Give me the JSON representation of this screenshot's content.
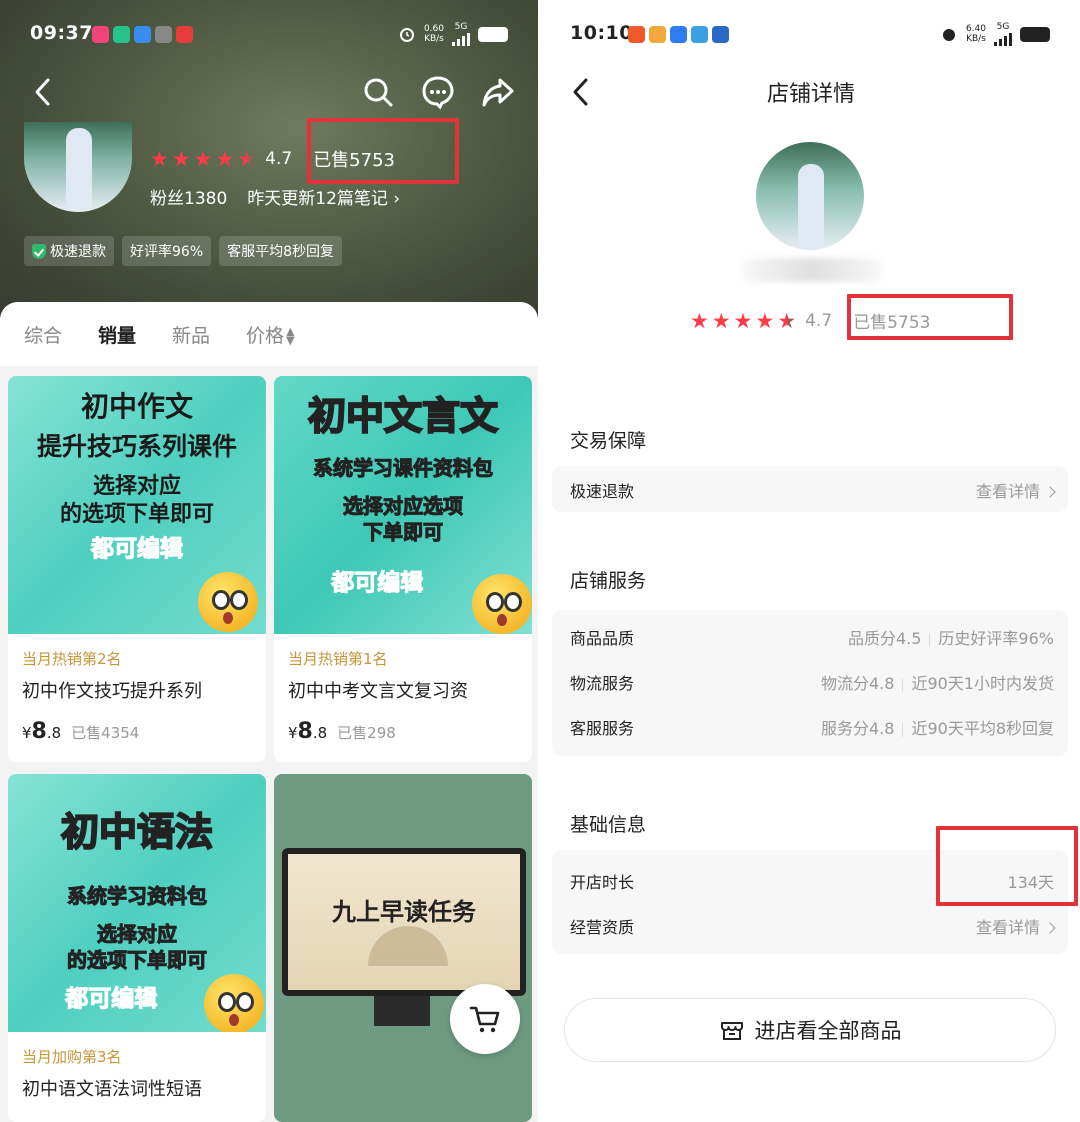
{
  "left": {
    "status": {
      "time": "09:37",
      "net_speed": "0.60",
      "net_unit": "KB/s",
      "net_type": "5G",
      "app_icons": [
        "#f0447a",
        "#28c28d",
        "#3b8cf0",
        "#888888",
        "#e83c3c"
      ]
    },
    "shop": {
      "rating": "4.7",
      "sold": "已售5753",
      "fans": "粉丝1380",
      "update": "昨天更新12篇笔记",
      "chips": [
        "极速退款",
        "好评率96%",
        "客服平均8秒回复"
      ]
    },
    "sort_tabs": [
      "综合",
      "销量",
      "新品",
      "价格"
    ],
    "products": [
      {
        "thumb_lines": [
          "初中作文",
          "提升技巧系列课件",
          "选择对应",
          "的选项下单即可",
          "都可编辑"
        ],
        "rank": "当月热销第2名",
        "title": "初中作文技巧提升系列",
        "currency": "¥",
        "price_int": "8",
        "price_dec": ".8",
        "sold": "已售4354"
      },
      {
        "thumb_lines": [
          "初中文言文",
          "系统学习课件资料包",
          "选择对应选项",
          "下单即可",
          "都可编辑"
        ],
        "rank": "当月热销第1名",
        "title": "初中中考文言文复习资",
        "currency": "¥",
        "price_int": "8",
        "price_dec": ".8",
        "sold": "已售298"
      },
      {
        "thumb_lines": [
          "初中语法",
          "系统学习资料包",
          "选择对应",
          "的选项下单即可",
          "都可编辑"
        ],
        "rank": "当月加购第3名",
        "title": "初中语文语法词性短语"
      },
      {
        "thumb_lines": [
          "九上早读任务"
        ]
      }
    ]
  },
  "right": {
    "status": {
      "time": "10:10",
      "net_speed": "6.40",
      "net_unit": "KB/s",
      "net_type": "5G",
      "app_icons": [
        "#f05a2a",
        "#f2a93b",
        "#2e7cf0",
        "#3aa0e0",
        "#2c69c7"
      ]
    },
    "title": "店铺详情",
    "rating": "4.7",
    "sold": "已售5753",
    "sections": {
      "trade": {
        "title": "交易保障",
        "rows": [
          {
            "label": "极速退款",
            "value": "查看详情"
          }
        ]
      },
      "service": {
        "title": "店铺服务",
        "rows": [
          {
            "label": "商品品质",
            "score": "品质分4.5",
            "detail": "历史好评率96%"
          },
          {
            "label": "物流服务",
            "score": "物流分4.8",
            "detail": "近90天1小时内发货"
          },
          {
            "label": "客服服务",
            "score": "服务分4.8",
            "detail": "近90天平均8秒回复"
          }
        ]
      },
      "basic": {
        "title": "基础信息",
        "rows": [
          {
            "label": "开店时长",
            "value": "134天"
          },
          {
            "label": "经营资质",
            "value": "查看详情"
          }
        ]
      }
    },
    "enter_button": "进店看全部商品"
  },
  "colors": {
    "accent_red": "#e0333b",
    "star_red": "#ff3b48",
    "rank_gold": "#c7953a"
  }
}
